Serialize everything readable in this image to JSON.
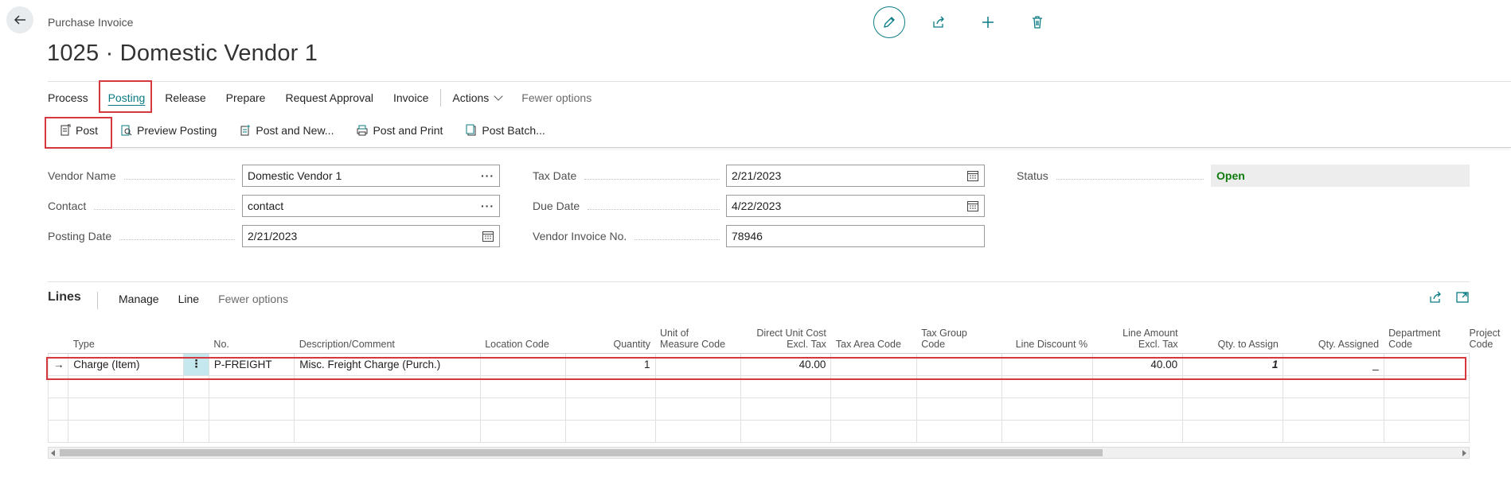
{
  "header": {
    "page_type": "Purchase Invoice",
    "title": "1025 · Domestic Vendor 1"
  },
  "top_actions": {
    "icons": [
      "edit-icon",
      "share-icon",
      "add-icon",
      "delete-icon"
    ]
  },
  "action_bar": {
    "tabs": [
      "Process",
      "Posting",
      "Release",
      "Prepare",
      "Request Approval",
      "Invoice"
    ],
    "actions_label": "Actions",
    "fewer_options": "Fewer options",
    "active_tab": "Posting"
  },
  "posting_actions": [
    "Post",
    "Preview Posting",
    "Post and New...",
    "Post and Print",
    "Post Batch..."
  ],
  "general": {
    "vendor_name_label": "Vendor Name",
    "vendor_name": "Domestic Vendor 1",
    "contact_label": "Contact",
    "contact": "contact",
    "posting_date_label": "Posting Date",
    "posting_date": "2/21/2023",
    "tax_date_label": "Tax Date",
    "tax_date": "2/21/2023",
    "due_date_label": "Due Date",
    "due_date": "4/22/2023",
    "vendor_invoice_no_label": "Vendor Invoice No.",
    "vendor_invoice_no": "78946",
    "status_label": "Status",
    "status": "Open",
    "status_color": "#107c10"
  },
  "lines": {
    "title": "Lines",
    "tabs": [
      "Manage",
      "Line"
    ],
    "fewer_options": "Fewer options",
    "columns": {
      "type": "Type",
      "no": "No.",
      "description": "Description/Comment",
      "location": "Location Code",
      "quantity": "Quantity",
      "uom_1": "Unit of",
      "uom_2": "Measure Code",
      "direct_cost_1": "Direct Unit Cost",
      "direct_cost_2": "Excl. Tax",
      "tax_area": "Tax Area Code",
      "tax_group_1": "Tax Group",
      "tax_group_2": "Code",
      "line_discount": "Line Discount %",
      "line_amount_1": "Line Amount",
      "line_amount_2": "Excl. Tax",
      "qty_to_assign": "Qty. to Assign",
      "qty_assigned": "Qty. Assigned",
      "department_1": "Department",
      "department_2": "Code",
      "project": "Project Code"
    },
    "row": {
      "indicator": "→",
      "type": "Charge (Item)",
      "no": "P-FREIGHT",
      "description": "Misc. Freight Charge (Purch.)",
      "location": "",
      "quantity": "1",
      "uom": "",
      "direct_cost": "40.00",
      "tax_area": "",
      "tax_group": "",
      "line_discount": "",
      "line_amount": "40.00",
      "qty_to_assign": "1",
      "qty_assigned": "_",
      "department": "",
      "project": ""
    }
  },
  "accent_color": "#0a7b83",
  "highlight_color": "#d7373f"
}
